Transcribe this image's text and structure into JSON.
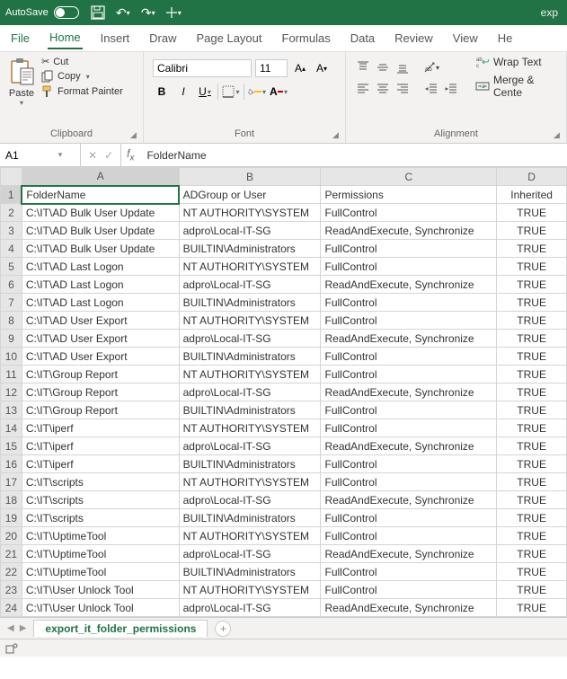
{
  "titlebar": {
    "autosave_label": "AutoSave",
    "autosave_state": "Off",
    "doc_title": "exp"
  },
  "tabs": {
    "file": "File",
    "home": "Home",
    "insert": "Insert",
    "draw": "Draw",
    "page_layout": "Page Layout",
    "formulas": "Formulas",
    "data": "Data",
    "review": "Review",
    "view": "View",
    "help": "He"
  },
  "ribbon": {
    "clipboard": {
      "paste": "Paste",
      "cut": "Cut",
      "copy": "Copy",
      "format_painter": "Format Painter",
      "group_label": "Clipboard"
    },
    "font": {
      "name": "Calibri",
      "size": "11",
      "group_label": "Font"
    },
    "alignment": {
      "wrap": "Wrap Text",
      "merge": "Merge & Cente",
      "group_label": "Alignment"
    }
  },
  "namebox": {
    "ref": "A1"
  },
  "formula_bar": {
    "value": "FolderName"
  },
  "columns": {
    "A": "A",
    "B": "B",
    "C": "C",
    "D": "D"
  },
  "headers": {
    "A": "FolderName",
    "B": "ADGroup or User",
    "C": "Permissions",
    "D": "Inherited"
  },
  "rows": [
    {
      "n": 2,
      "A": "C:\\IT\\AD Bulk User Update",
      "B": "NT AUTHORITY\\SYSTEM",
      "C": "FullControl",
      "D": "TRUE"
    },
    {
      "n": 3,
      "A": "C:\\IT\\AD Bulk User Update",
      "B": "adpro\\Local-IT-SG",
      "C": "ReadAndExecute, Synchronize",
      "D": "TRUE"
    },
    {
      "n": 4,
      "A": "C:\\IT\\AD Bulk User Update",
      "B": "BUILTIN\\Administrators",
      "C": "FullControl",
      "D": "TRUE"
    },
    {
      "n": 5,
      "A": "C:\\IT\\AD Last Logon",
      "B": "NT AUTHORITY\\SYSTEM",
      "C": "FullControl",
      "D": "TRUE"
    },
    {
      "n": 6,
      "A": "C:\\IT\\AD Last Logon",
      "B": "adpro\\Local-IT-SG",
      "C": "ReadAndExecute, Synchronize",
      "D": "TRUE"
    },
    {
      "n": 7,
      "A": "C:\\IT\\AD Last Logon",
      "B": "BUILTIN\\Administrators",
      "C": "FullControl",
      "D": "TRUE"
    },
    {
      "n": 8,
      "A": "C:\\IT\\AD User Export",
      "B": "NT AUTHORITY\\SYSTEM",
      "C": "FullControl",
      "D": "TRUE"
    },
    {
      "n": 9,
      "A": "C:\\IT\\AD User Export",
      "B": "adpro\\Local-IT-SG",
      "C": "ReadAndExecute, Synchronize",
      "D": "TRUE"
    },
    {
      "n": 10,
      "A": "C:\\IT\\AD User Export",
      "B": "BUILTIN\\Administrators",
      "C": "FullControl",
      "D": "TRUE"
    },
    {
      "n": 11,
      "A": "C:\\IT\\Group Report",
      "B": "NT AUTHORITY\\SYSTEM",
      "C": "FullControl",
      "D": "TRUE"
    },
    {
      "n": 12,
      "A": "C:\\IT\\Group Report",
      "B": "adpro\\Local-IT-SG",
      "C": "ReadAndExecute, Synchronize",
      "D": "TRUE"
    },
    {
      "n": 13,
      "A": "C:\\IT\\Group Report",
      "B": "BUILTIN\\Administrators",
      "C": "FullControl",
      "D": "TRUE"
    },
    {
      "n": 14,
      "A": "C:\\IT\\iperf",
      "B": "NT AUTHORITY\\SYSTEM",
      "C": "FullControl",
      "D": "TRUE"
    },
    {
      "n": 15,
      "A": "C:\\IT\\iperf",
      "B": "adpro\\Local-IT-SG",
      "C": "ReadAndExecute, Synchronize",
      "D": "TRUE"
    },
    {
      "n": 16,
      "A": "C:\\IT\\iperf",
      "B": "BUILTIN\\Administrators",
      "C": "FullControl",
      "D": "TRUE"
    },
    {
      "n": 17,
      "A": "C:\\IT\\scripts",
      "B": "NT AUTHORITY\\SYSTEM",
      "C": "FullControl",
      "D": "TRUE"
    },
    {
      "n": 18,
      "A": "C:\\IT\\scripts",
      "B": "adpro\\Local-IT-SG",
      "C": "ReadAndExecute, Synchronize",
      "D": "TRUE"
    },
    {
      "n": 19,
      "A": "C:\\IT\\scripts",
      "B": "BUILTIN\\Administrators",
      "C": "FullControl",
      "D": "TRUE"
    },
    {
      "n": 20,
      "A": "C:\\IT\\UptimeTool",
      "B": "NT AUTHORITY\\SYSTEM",
      "C": "FullControl",
      "D": "TRUE"
    },
    {
      "n": 21,
      "A": "C:\\IT\\UptimeTool",
      "B": "adpro\\Local-IT-SG",
      "C": "ReadAndExecute, Synchronize",
      "D": "TRUE"
    },
    {
      "n": 22,
      "A": "C:\\IT\\UptimeTool",
      "B": "BUILTIN\\Administrators",
      "C": "FullControl",
      "D": "TRUE"
    },
    {
      "n": 23,
      "A": "C:\\IT\\User Unlock Tool",
      "B": "NT AUTHORITY\\SYSTEM",
      "C": "FullControl",
      "D": "TRUE"
    },
    {
      "n": 24,
      "A": "C:\\IT\\User Unlock Tool",
      "B": "adpro\\Local-IT-SG",
      "C": "ReadAndExecute, Synchronize",
      "D": "TRUE"
    }
  ],
  "sheet": {
    "name": "export_it_folder_permissions"
  },
  "colors": {
    "accent": "#217346",
    "fill": "#ffc000",
    "font_color": "#c00000"
  }
}
